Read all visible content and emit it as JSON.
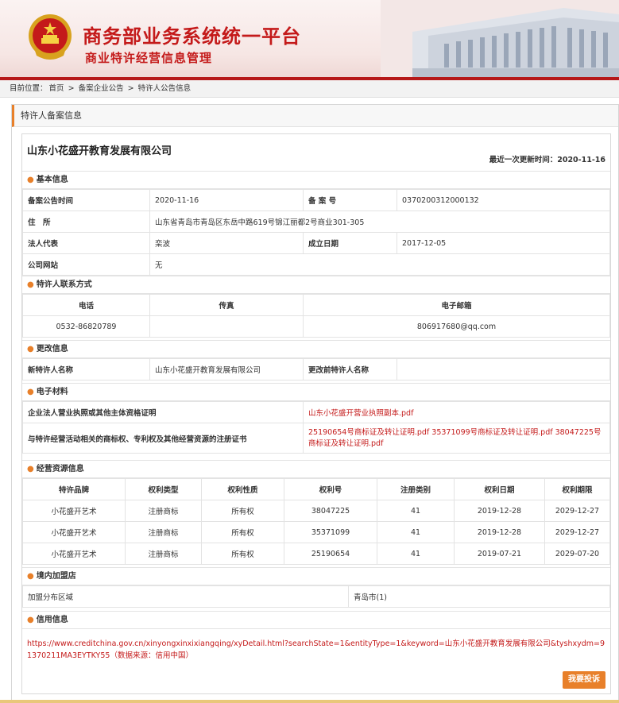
{
  "header": {
    "title_main": "商务部业务系统统一平台",
    "title_sub": "商业特许经营信息管理"
  },
  "breadcrumb": {
    "prefix": "目前位置：",
    "items": [
      "首页",
      "备案企业公告",
      "特许人公告信息"
    ],
    "separator": ">"
  },
  "panel": {
    "title": "特许人备案信息"
  },
  "company": {
    "name": "山东小花盛开教育发展有限公司",
    "last_update_label": "最近一次更新时间：",
    "last_update": "2020-11-16"
  },
  "basic": {
    "section": "基本信息",
    "announce_time_label": "备案公告时间",
    "announce_time": "2020-11-16",
    "record_no_label": "备 案 号",
    "record_no": "0370200312000132",
    "address_label": "住　所",
    "address": "山东省青岛市青岛区东岳中路619号锦江丽都2号商业301-305",
    "legal_rep_label": "法人代表",
    "legal_rep": "栾波",
    "founded_label": "成立日期",
    "founded": "2017-12-05",
    "website_label": "公司网站",
    "website": "无"
  },
  "contact": {
    "section": "特许人联系方式",
    "headers": [
      "电话",
      "传真",
      "电子邮箱"
    ],
    "phone": "0532-86820789",
    "fax": "",
    "email": "806917680@qq.com"
  },
  "change": {
    "section": "更改信息",
    "new_name_label": "新特许人名称",
    "new_name": "山东小花盛开教育发展有限公司",
    "old_name_label": "更改前特许人名称",
    "old_name": ""
  },
  "materials": {
    "section": "电子材料",
    "license_label": "企业法人营业执照或其他主体资格证明",
    "license_file": "山东小花盛开营业执照副本.pdf",
    "ip_label": "与特许经营活动相关的商标权、专利权及其他经营资源的注册证书",
    "ip_files": "25190654号商标证及转让证明.pdf 35371099号商标证及转让证明.pdf 38047225号商标证及转让证明.pdf"
  },
  "resources": {
    "section": "经营资源信息",
    "headers": [
      "特许品牌",
      "权利类型",
      "权利性质",
      "权利号",
      "注册类别",
      "权利日期",
      "权利期限"
    ],
    "rows": [
      [
        "小花盛开艺术",
        "注册商标",
        "所有权",
        "38047225",
        "41",
        "2019-12-28",
        "2029-12-27"
      ],
      [
        "小花盛开艺术",
        "注册商标",
        "所有权",
        "35371099",
        "41",
        "2019-12-28",
        "2029-12-27"
      ],
      [
        "小花盛开艺术",
        "注册商标",
        "所有权",
        "25190654",
        "41",
        "2019-07-21",
        "2029-07-20"
      ]
    ]
  },
  "stores": {
    "section": "境内加盟店",
    "region_label": "加盟分布区域",
    "region": "青岛市(1)"
  },
  "credit": {
    "section": "信用信息",
    "url": "https://www.creditchina.gov.cn/xinyongxinxixiangqing/xyDetail.html?searchState=1&entityType=1&keyword=山东小花盛开教育发展有限公司&tyshxydm=91370211MA3EYTKY55",
    "source": "（数据来源：信用中国）"
  },
  "complaint_button": "我要投诉",
  "colors": {
    "brand_red": "#c41a1a",
    "accent_orange": "#e8802a"
  }
}
